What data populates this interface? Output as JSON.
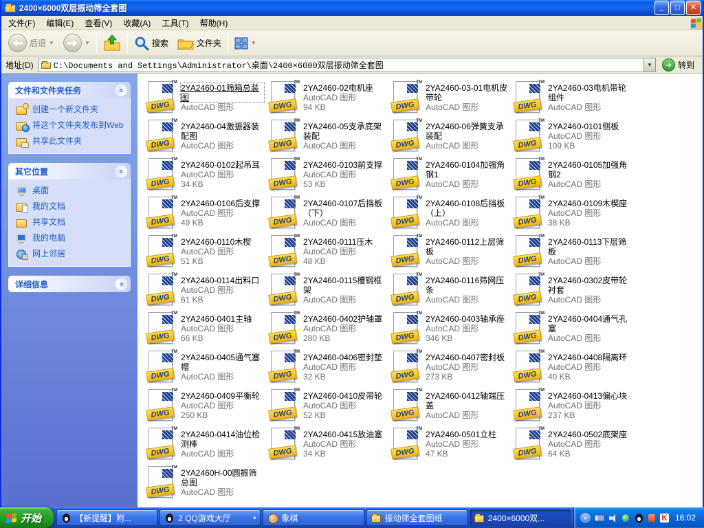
{
  "window": {
    "title": "2400×6000双层振动筛全套图"
  },
  "menu": {
    "items": [
      "文件(F)",
      "编辑(E)",
      "查看(V)",
      "收藏(A)",
      "工具(T)",
      "帮助(H)"
    ]
  },
  "toolbar": {
    "back": "后退",
    "search": "搜索",
    "folders": "文件夹"
  },
  "address": {
    "label": "地址(D)",
    "path": "C:\\Documents and Settings\\Administrator\\桌面\\2400×6000双层振动筛全套图",
    "go": "转到"
  },
  "sidebar": {
    "panels": [
      {
        "title": "文件和文件夹任务",
        "collapsed": false,
        "items": [
          {
            "label": "创建一个新文件夹",
            "icon": "new-folder-icon"
          },
          {
            "label": "将这个文件夹发布到Web",
            "icon": "publish-web-icon"
          },
          {
            "label": "共享此文件夹",
            "icon": "share-folder-icon"
          }
        ]
      },
      {
        "title": "其它位置",
        "collapsed": false,
        "items": [
          {
            "label": "桌面",
            "icon": "desktop-icon"
          },
          {
            "label": "我的文档",
            "icon": "my-documents-icon"
          },
          {
            "label": "共享文档",
            "icon": "shared-documents-icon"
          },
          {
            "label": "我的电脑",
            "icon": "my-computer-icon"
          },
          {
            "label": "网上邻居",
            "icon": "network-icon"
          }
        ]
      },
      {
        "title": "详细信息",
        "collapsed": true,
        "items": []
      }
    ]
  },
  "dwg_icon": {
    "label": "DWG",
    "tm": "TM"
  },
  "files": [
    {
      "name": "2YA2460-01筛箱总装图",
      "type": "AutoCAD 图形",
      "size": "",
      "selected": true
    },
    {
      "name": "2YA2460-02电机座",
      "type": "AutoCAD 图形",
      "size": "94 KB"
    },
    {
      "name": "2YA2460-03-01电机皮带轮",
      "type": "AutoCAD 图形",
      "size": ""
    },
    {
      "name": "2YA2460-03电机带轮组件",
      "type": "AutoCAD 图形",
      "size": ""
    },
    {
      "name": "2YA2460-04激振器装配图",
      "type": "AutoCAD 图形",
      "size": ""
    },
    {
      "name": "2YA2460-05支承底架装配",
      "type": "AutoCAD 图形",
      "size": ""
    },
    {
      "name": "2YA2460-06弹簧支承装配",
      "type": "AutoCAD 图形",
      "size": ""
    },
    {
      "name": "2YA2460-0101侧板",
      "type": "AutoCAD 图形",
      "size": "109 KB"
    },
    {
      "name": "2YA2460-0102起吊耳",
      "type": "AutoCAD 图形",
      "size": "34 KB"
    },
    {
      "name": "2YA2460-0103前支撑",
      "type": "AutoCAD 图形",
      "size": "53 KB"
    },
    {
      "name": "2YA2460-0104加强角钢1",
      "type": "AutoCAD 图形",
      "size": ""
    },
    {
      "name": "2YA2460-0105加强角钢2",
      "type": "AutoCAD 图形",
      "size": ""
    },
    {
      "name": "2YA2460-0106后支撑",
      "type": "AutoCAD 图形",
      "size": "49 KB"
    },
    {
      "name": "2YA2460-0107后挡板（下）",
      "type": "AutoCAD 图形",
      "size": ""
    },
    {
      "name": "2YA2460-0108后挡板（上）",
      "type": "AutoCAD 图形",
      "size": ""
    },
    {
      "name": "2YA2460-0109木楔座",
      "type": "AutoCAD 图形",
      "size": "38 KB"
    },
    {
      "name": "2YA2460-0110木楔",
      "type": "AutoCAD 图形",
      "size": "51 KB"
    },
    {
      "name": "2YA2460-0111压木",
      "type": "AutoCAD 图形",
      "size": "48 KB"
    },
    {
      "name": "2YA2460-0112上层筛板",
      "type": "AutoCAD 图形",
      "size": ""
    },
    {
      "name": "2YA2460-0113下层筛板",
      "type": "AutoCAD 图形",
      "size": ""
    },
    {
      "name": "2YA2460-0114出料口",
      "type": "AutoCAD 图形",
      "size": "61 KB"
    },
    {
      "name": "2YA2460-0115槽钢框架",
      "type": "AutoCAD 图形",
      "size": ""
    },
    {
      "name": "2YA2460-0116筛网压条",
      "type": "AutoCAD 图形",
      "size": ""
    },
    {
      "name": "2YA2460-0302皮带轮衬套",
      "type": "AutoCAD 图形",
      "size": ""
    },
    {
      "name": "2YA2460-0401主轴",
      "type": "AutoCAD 图形",
      "size": "66 KB"
    },
    {
      "name": "2YA2460-0402护轴罩",
      "type": "AutoCAD 图形",
      "size": "280 KB"
    },
    {
      "name": "2YA2460-0403轴承座",
      "type": "AutoCAD 图形",
      "size": "346 KB"
    },
    {
      "name": "2YA2460-0404通气孔塞",
      "type": "AutoCAD 图形",
      "size": ""
    },
    {
      "name": "2YA2460-0405通气塞帽",
      "type": "AutoCAD 图形",
      "size": ""
    },
    {
      "name": "2YA2460-0406密封垫",
      "type": "AutoCAD 图形",
      "size": "32 KB"
    },
    {
      "name": "2YA2460-0407密封板",
      "type": "AutoCAD 图形",
      "size": "273 KB"
    },
    {
      "name": "2YA2460-0408隔离环",
      "type": "AutoCAD 图形",
      "size": "40 KB"
    },
    {
      "name": "2YA2460-0409平衡轮",
      "type": "AutoCAD 图形",
      "size": "250 KB"
    },
    {
      "name": "2YA2460-0410皮带轮",
      "type": "AutoCAD 图形",
      "size": "52 KB"
    },
    {
      "name": "2YA2460-0412轴端压盖",
      "type": "AutoCAD 图形",
      "size": ""
    },
    {
      "name": "2YA2460-0413偏心块",
      "type": "AutoCAD 图形",
      "size": "237 KB"
    },
    {
      "name": "2YA2460-0414油位检测棒",
      "type": "AutoCAD 图形",
      "size": ""
    },
    {
      "name": "2YA2460-0415放油塞",
      "type": "AutoCAD 图形",
      "size": "34 KB"
    },
    {
      "name": "2YA2460-0501立柱",
      "type": "AutoCAD 图形",
      "size": "47 KB"
    },
    {
      "name": "2YA2460-0502底架座",
      "type": "AutoCAD 图形",
      "size": "64 KB"
    },
    {
      "name": "2YA2460H-00圆振筛总图",
      "type": "AutoCAD 图形",
      "size": ""
    }
  ],
  "taskbar": {
    "start": "开始",
    "tasks": [
      {
        "label": "【新提醒】附...",
        "icon": "qq-message-icon",
        "active": false,
        "grouped": false
      },
      {
        "label": "2 QQ游戏大厅",
        "icon": "qq-game-icon",
        "active": false,
        "grouped": true
      },
      {
        "label": "象棋",
        "icon": "chess-icon",
        "active": false,
        "grouped": false
      },
      {
        "label": "振动筛全套图纸",
        "icon": "folder-icon",
        "active": false,
        "grouped": false
      },
      {
        "label": "2400×6000双...",
        "icon": "folder-icon",
        "active": true,
        "grouped": false
      }
    ],
    "tray": {
      "icons": [
        {
          "name": "input-method-icon"
        },
        {
          "name": "volume-icon"
        },
        {
          "name": "messenger-icon"
        },
        {
          "name": "qq-icon"
        },
        {
          "name": "security-icon"
        },
        {
          "name": "kingsoft-icon",
          "text": "K"
        }
      ],
      "time": "16:02"
    }
  }
}
